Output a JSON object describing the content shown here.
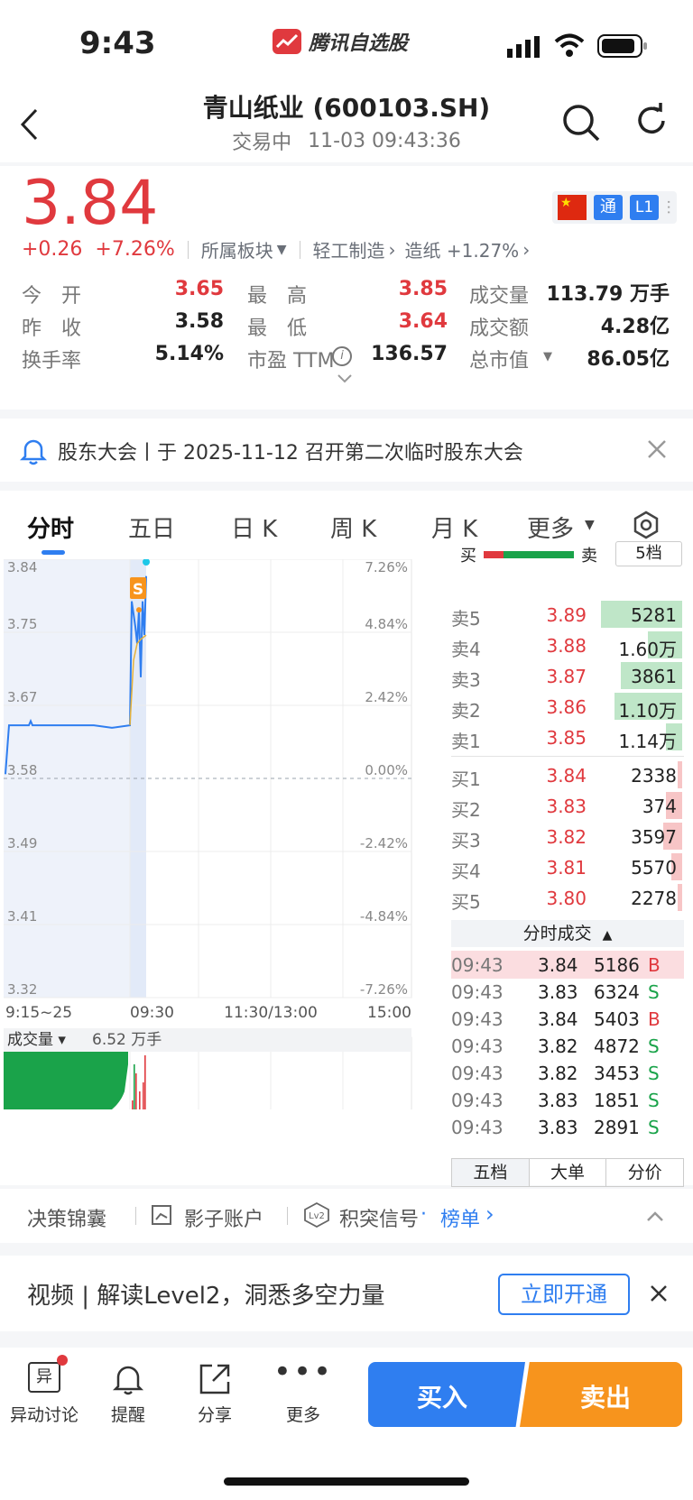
{
  "status_bar": {
    "time": "9:43",
    "app_name": "腾讯自选股"
  },
  "header": {
    "title": "青山纸业 (600103.SH)",
    "status": "交易中",
    "datetime": "11-03 09:43:36"
  },
  "quote": {
    "price": "3.84",
    "change": "+0.26",
    "change_pct": "+7.26%",
    "sector_label": "所属板块",
    "sector1": "轻工制造",
    "sector2": "造纸 +1.27%",
    "badges": {
      "tong": "通",
      "level": "L1"
    },
    "stats": [
      {
        "label": "今　开",
        "value": "3.65",
        "color": "red"
      },
      {
        "label": "最　高",
        "value": "3.85",
        "color": "red"
      },
      {
        "label": "成交量",
        "value": "113.79 万手",
        "color": "black"
      },
      {
        "label": "昨　收",
        "value": "3.58",
        "color": "black"
      },
      {
        "label": "最　低",
        "value": "3.64",
        "color": "red"
      },
      {
        "label": "成交额",
        "value": "4.28亿",
        "color": "black"
      },
      {
        "label": "换手率",
        "value": "5.14%",
        "color": "black"
      },
      {
        "label": "市盈 TTM",
        "value": "136.57",
        "color": "black"
      },
      {
        "label": "总市值",
        "value": "86.05亿",
        "color": "black"
      }
    ]
  },
  "notice": {
    "text": "股东大会丨于 2025-11-12 召开第二次临时股东大会"
  },
  "chart_tabs": [
    "分时",
    "五日",
    "日 K",
    "周 K",
    "月 K",
    "更多"
  ],
  "chart_data": {
    "type": "line",
    "y_price_ticks": [
      "3.84",
      "3.75",
      "3.67",
      "3.58",
      "3.49",
      "3.41",
      "3.32"
    ],
    "y_pct_ticks": [
      "7.26%",
      "4.84%",
      "2.42%",
      "0.00%",
      "-2.42%",
      "-4.84%",
      "-7.26%"
    ],
    "x_ticks": [
      "9:15~25",
      "09:30",
      "11:30/13:00",
      "15:00"
    ],
    "ylim": [
      3.32,
      3.84
    ],
    "pre_close": 3.58,
    "series": [
      {
        "values": [
          3.585,
          3.643,
          3.643,
          3.648,
          3.643,
          3.643,
          3.643,
          3.643,
          3.643,
          3.64,
          3.643,
          3.79,
          3.76,
          3.74,
          3.78,
          3.7,
          3.79,
          3.75,
          3.82
        ]
      }
    ],
    "marker": "S",
    "volume_label": "成交量",
    "volume_value": "6.52 万手"
  },
  "orderbook": {
    "header_buy": "买",
    "header_sell": "卖",
    "levels_label": "5档",
    "asks": [
      {
        "label": "卖5",
        "price": "3.89",
        "vol": "5281",
        "bar": 0.6
      },
      {
        "label": "卖4",
        "price": "3.88",
        "vol": "1.60万",
        "bar": 0.25
      },
      {
        "label": "卖3",
        "price": "3.87",
        "vol": "3861",
        "bar": 0.45
      },
      {
        "label": "卖2",
        "price": "3.86",
        "vol": "1.10万",
        "bar": 0.5
      },
      {
        "label": "卖1",
        "price": "3.85",
        "vol": "1.14万",
        "bar": 0.12
      }
    ],
    "bids": [
      {
        "label": "买1",
        "price": "3.84",
        "vol": "2338",
        "bar": 0.03
      },
      {
        "label": "买2",
        "price": "3.83",
        "vol": "374",
        "bar": 0.12
      },
      {
        "label": "买3",
        "price": "3.82",
        "vol": "3597",
        "bar": 0.14
      },
      {
        "label": "买4",
        "price": "3.81",
        "vol": "5570",
        "bar": 0.08
      },
      {
        "label": "买5",
        "price": "3.80",
        "vol": "2278",
        "bar": 0.03
      }
    ],
    "ticks_title": "分时成交",
    "ticks": [
      {
        "time": "09:43",
        "price": "3.84",
        "vol": "5186",
        "side": "B"
      },
      {
        "time": "09:43",
        "price": "3.83",
        "vol": "6324",
        "side": "S"
      },
      {
        "time": "09:43",
        "price": "3.84",
        "vol": "5403",
        "side": "B"
      },
      {
        "time": "09:43",
        "price": "3.82",
        "vol": "4872",
        "side": "S"
      },
      {
        "time": "09:43",
        "price": "3.82",
        "vol": "3453",
        "side": "S"
      },
      {
        "time": "09:43",
        "price": "3.83",
        "vol": "1851",
        "side": "S"
      },
      {
        "time": "09:43",
        "price": "3.83",
        "vol": "2891",
        "side": "S"
      }
    ],
    "bottom_tabs": [
      "五档",
      "大单",
      "分价"
    ]
  },
  "tools": {
    "item1": "决策锦囊",
    "item2": "影子账户",
    "item3": "积突信号",
    "item3_link": "榜单"
  },
  "promo": {
    "text": "视频 | 解读Level2，洞悉多空力量",
    "button": "立即开通"
  },
  "bottom_nav": {
    "items": [
      {
        "label": "异动讨论",
        "icon_text": "异"
      },
      {
        "label": "提醒"
      },
      {
        "label": "分享"
      },
      {
        "label": "更多"
      }
    ],
    "buy": "买入",
    "sell": "卖出"
  }
}
